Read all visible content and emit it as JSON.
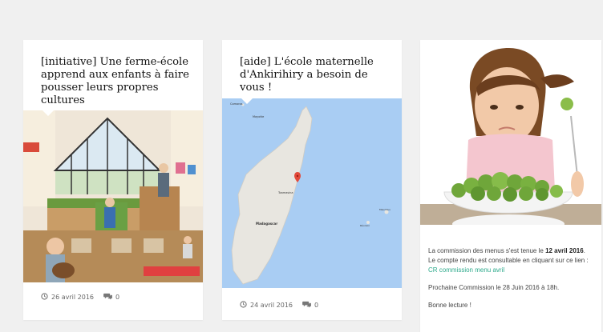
{
  "cards": [
    {
      "title": "[initiative] Une ferme-école apprend aux enfants à faire pousser leurs propres cultures",
      "image": "farm-school-illustration",
      "date": "26 avril 2016",
      "comments": "0"
    },
    {
      "title": "[aide] L'école maternelle d'Ankirihiry a besoin de vous !",
      "image": "madagascar-map",
      "date": "24 avril 2016",
      "comments": "0",
      "map_labels": {
        "top_left": "Comoros",
        "north": "Mayotte",
        "center": "Toamasina",
        "island": "Madagascar",
        "east1": "Mauritius",
        "east2": "Réunion"
      }
    },
    {
      "image": "girl-with-brussels-sprouts",
      "text_pre_date": "La commission des menus s'est tenue le",
      "date_bold": "12 avril 2016",
      "text_post_date": ". Le compte rendu est consultable en cliquant sur ce lien :",
      "link_text": "CR commission menu avril",
      "next": "Prochaine Commission le 28 Juin 2016 à 18h.",
      "closing": "Bonne lecture !"
    }
  ],
  "colors": {
    "page_bg": "#f0f0f0",
    "link": "#2eaa8c",
    "map_sea": "#a9cdf3",
    "map_land": "#e8e6e0"
  },
  "icons": {
    "date": "clock-icon",
    "comments": "comment-icon"
  }
}
